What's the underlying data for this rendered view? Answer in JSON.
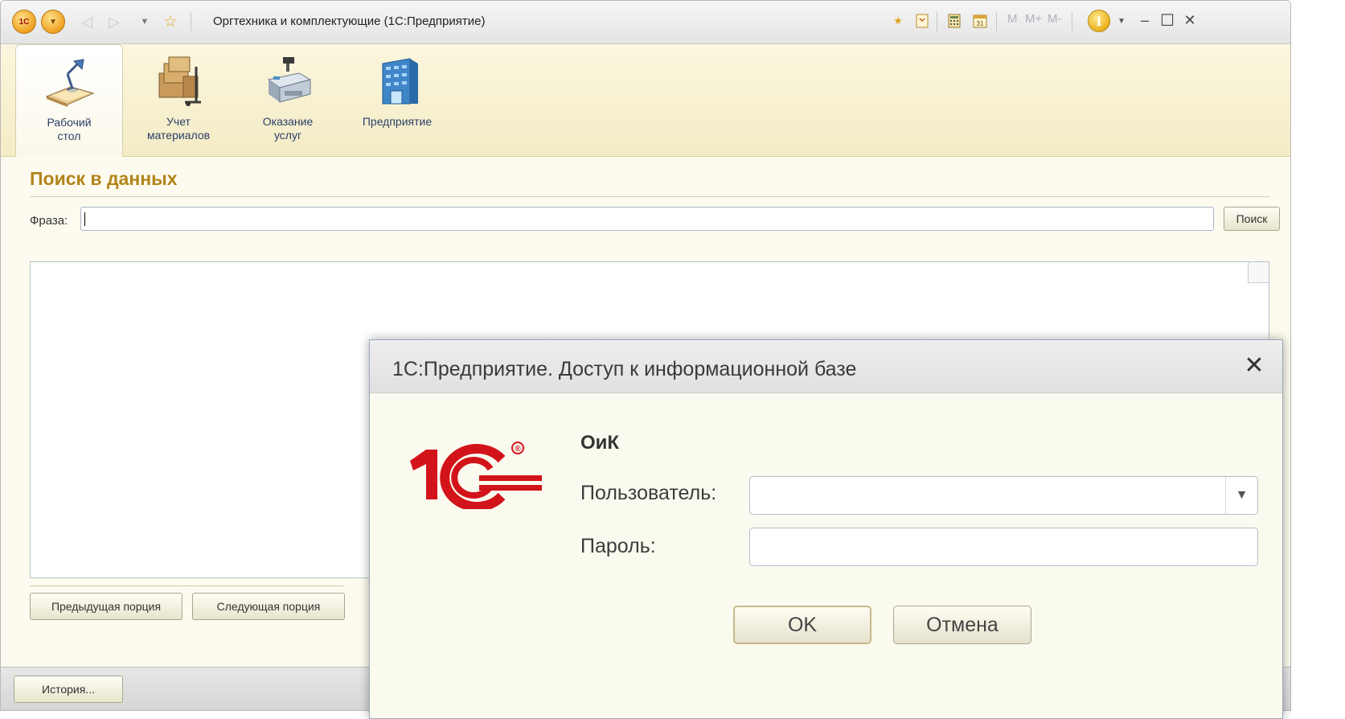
{
  "window": {
    "title": "Оргтехника и комплектующие  (1С:Предприятие)",
    "logo_text": "1С",
    "memory_buttons": [
      "M",
      "M+",
      "M-"
    ],
    "calendar_day": "31",
    "info_label": "i"
  },
  "sections": [
    {
      "label": "Рабочий\nстол",
      "icon": "desk-lamp-icon"
    },
    {
      "label": "Учет\nматериалов",
      "icon": "warehouse-boxes-icon"
    },
    {
      "label": "Оказание\nуслуг",
      "icon": "cash-register-icon"
    },
    {
      "label": "Предприятие",
      "icon": "building-icon"
    }
  ],
  "search": {
    "title": "Поиск в данных",
    "phrase_label": "Фраза:",
    "phrase_value": "",
    "search_button": "Поиск",
    "prev_button": "Предыдущая порция",
    "next_button": "Следующая порция"
  },
  "status": {
    "history_button": "История..."
  },
  "dialog": {
    "title": "1С:Предприятие. Доступ к информационной базе",
    "brand_text": "1С",
    "registered_mark": "®",
    "infobase_name": "ОиК",
    "user_label": "Пользователь:",
    "user_value": "",
    "password_label": "Пароль:",
    "password_value": "",
    "ok_button": "OK",
    "cancel_button": "Отмена",
    "close_glyph": "✕"
  },
  "colors": {
    "accent": "#b2841a",
    "brand_red": "#d2131a",
    "section_text": "#2a3f67"
  }
}
